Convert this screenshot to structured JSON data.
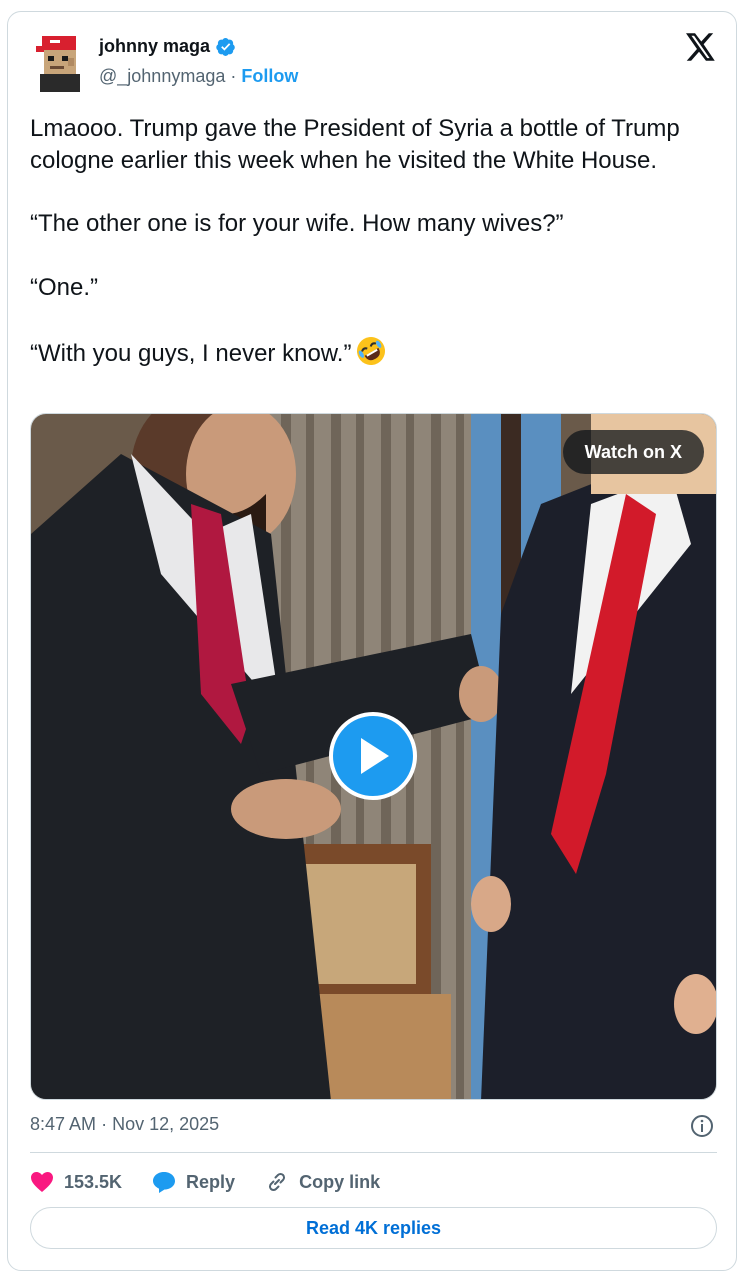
{
  "author": {
    "name": "johnny maga",
    "handle": "@_johnnymaga",
    "separator": "·",
    "follow_label": "Follow",
    "verified_icon": "verified-badge-icon",
    "avatar_icon": "pixel-avatar-red-cap"
  },
  "tweet": {
    "paragraphs": [
      "Lmaooo. Trump gave the President of Syria a bottle of Trump cologne earlier this week when he visited the White House.",
      "“The other one is for your wife. How many wives?”",
      "“One.”",
      "“With you guys, I never know.”"
    ],
    "emoji": "rolling-on-floor-laughing-emoji"
  },
  "media": {
    "watch_label": "Watch on X",
    "play_icon": "play-icon"
  },
  "timestamp": {
    "time": "8:47 AM",
    "separator": "·",
    "date": "Nov 12, 2025"
  },
  "actions": {
    "likes_count": "153.5K",
    "reply_label": "Reply",
    "copy_label": "Copy link"
  },
  "read_replies_label": "Read 4K replies",
  "colors": {
    "accent": "#1d9bf0",
    "link": "#006fd6",
    "like": "#f91880",
    "muted": "#536471",
    "border": "#cfd9de"
  }
}
